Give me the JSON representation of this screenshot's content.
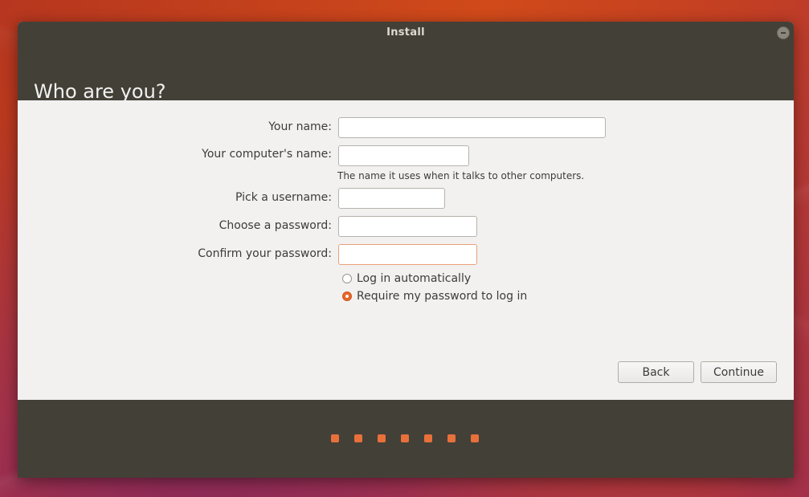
{
  "window": {
    "title": "Install"
  },
  "page": {
    "heading": "Who are you?"
  },
  "form": {
    "name_label": "Your name:",
    "name_value": "",
    "computer_label": "Your computer's name:",
    "computer_value": "",
    "computer_hint": "The name it uses when it talks to other computers.",
    "username_label": "Pick a username:",
    "username_value": "",
    "password_label": "Choose a password:",
    "password_value": "",
    "confirm_label": "Confirm your password:",
    "confirm_value": ""
  },
  "login_options": {
    "auto_label": "Log in automatically",
    "require_label": "Require my password to log in",
    "selected": "require"
  },
  "buttons": {
    "back_label": "Back",
    "continue_label": "Continue"
  },
  "progress": {
    "total_steps": 7
  },
  "colors": {
    "accent": "#e8652a",
    "chrome": "#434038",
    "content_bg": "#f2f1f0"
  },
  "icons": {
    "window_close": "close-icon",
    "progress_step": "progress-dot"
  }
}
